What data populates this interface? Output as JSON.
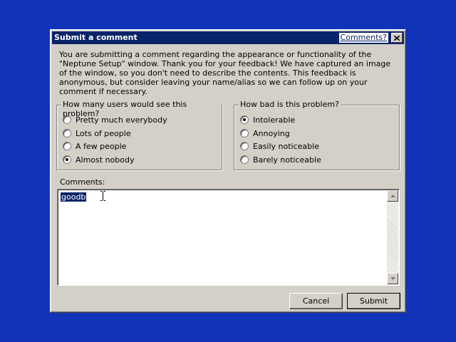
{
  "dialog": {
    "title": "Submit a comment",
    "title_link": "Comments?",
    "intro": "You are submitting a comment regarding the appearance or functionality of the \"Neptune Setup\" window. Thank you for your feedback! We have captured an image of the window, so you don't need to describe the contents. This feedback is anonymous, but consider leaving your name/alias so we can follow up on your comment if necessary."
  },
  "users_group": {
    "legend": "How many users would see this problem?",
    "options": [
      {
        "label": "Pretty much everybody",
        "checked": false
      },
      {
        "label": "Lots of people",
        "checked": false
      },
      {
        "label": "A few people",
        "checked": false
      },
      {
        "label": "Almost nobody",
        "checked": true
      }
    ]
  },
  "severity_group": {
    "legend": "How bad is this problem?",
    "options": [
      {
        "label": "Intolerable",
        "checked": true
      },
      {
        "label": "Annoying",
        "checked": false
      },
      {
        "label": "Easily noticeable",
        "checked": false
      },
      {
        "label": "Barely noticeable",
        "checked": false
      }
    ]
  },
  "comments": {
    "label": "Comments:",
    "value": "goodb"
  },
  "buttons": {
    "cancel": "Cancel",
    "submit": "Submit"
  },
  "colors": {
    "desktop": "#1133b8",
    "titlebar": "#0a246a",
    "face": "#d4d0c8",
    "selection": "#0a246a"
  },
  "icons": {
    "close": "close-icon",
    "scroll_up": "scroll-up-arrow-icon",
    "scroll_down": "scroll-down-arrow-icon",
    "cursor": "text-cursor-icon"
  }
}
